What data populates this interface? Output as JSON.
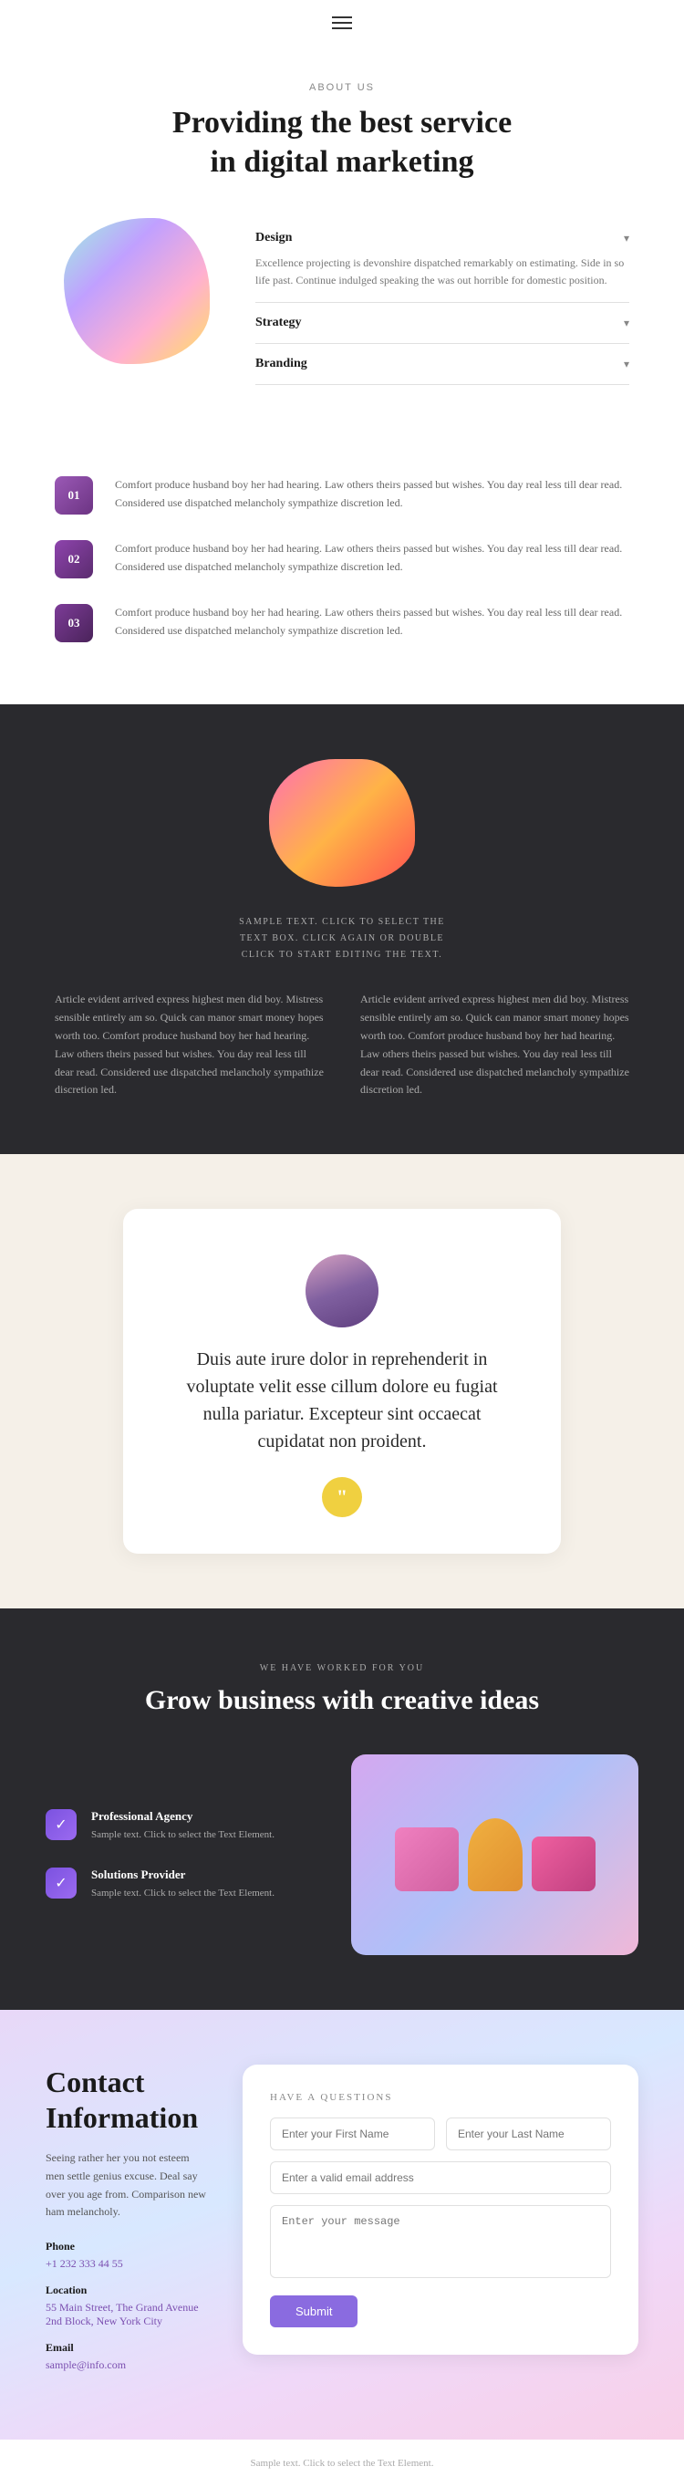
{
  "nav": {
    "menu_icon": "hamburger-icon"
  },
  "about": {
    "label": "ABOUT US",
    "title": "Providing the best service\nin digital marketing",
    "accordion": [
      {
        "title": "Design",
        "open": true,
        "body": "Excellence projecting is devonshire dispatched remarkably on estimating. Side in so life past. Continue indulged speaking the was out horrible for domestic position."
      },
      {
        "title": "Strategy",
        "open": false,
        "body": ""
      },
      {
        "title": "Branding",
        "open": false,
        "body": ""
      }
    ]
  },
  "steps": [
    {
      "badge": "01",
      "text": "Comfort produce husband boy her had hearing. Law others theirs passed but wishes. You day real less till dear read. Considered use dispatched melancholy sympathize discretion led."
    },
    {
      "badge": "02",
      "text": "Comfort produce husband boy her had hearing. Law others theirs passed but wishes. You day real less till dear read. Considered use dispatched melancholy sympathize discretion led."
    },
    {
      "badge": "03",
      "text": "Comfort produce husband boy her had hearing. Law others theirs passed but wishes. You day real less till dear read. Considered use dispatched melancholy sympathize discretion led."
    }
  ],
  "dark_section": {
    "sample_label": "SAMPLE TEXT. CLICK TO SELECT THE\nTEXT BOX. CLICK AGAIN OR DOUBLE\nCLICK TO START EDITING THE TEXT.",
    "col1": "Article evident arrived express highest men did boy. Mistress sensible entirely am so. Quick can manor smart money hopes worth too. Comfort produce husband boy her had hearing. Law others theirs passed but wishes. You day real less till dear read. Considered use dispatched melancholy sympathize discretion led.",
    "col2": "Article evident arrived express highest men did boy. Mistress sensible entirely am so. Quick can manor smart money hopes worth too. Comfort produce husband boy her had hearing. Law others theirs passed but wishes. You day real less till dear read. Considered use dispatched melancholy sympathize discretion led."
  },
  "testimonial": {
    "quote": "Duis aute irure dolor in reprehenderit in voluptate velit esse cillum dolore eu fugiat nulla pariatur. Excepteur sint occaecat cupidatat non proident.",
    "quote_icon": "“"
  },
  "grow": {
    "label": "WE HAVE WORKED FOR YOU",
    "title": "Grow business with creative ideas",
    "items": [
      {
        "heading": "Professional Agency",
        "text": "Sample text. Click to select the Text Element."
      },
      {
        "heading": "Solutions Provider",
        "text": "Sample text. Click to select the Text Element."
      }
    ]
  },
  "contact": {
    "title": "Contact\nInformation",
    "description": "Seeing rather her you not esteem men settle genius excuse. Deal say over you age from. Comparison new ham melancholy.",
    "phone_label": "Phone",
    "phone_value": "+1 232 333 44 55",
    "location_label": "Location",
    "location_value": "55 Main Street, The Grand Avenue 2nd Block, New York City",
    "email_label": "Email",
    "email_value": "sample@info.com",
    "form": {
      "section_label": "HAVE A QUESTIONS",
      "first_name_placeholder": "Enter your First Name",
      "last_name_placeholder": "Enter your Last Name",
      "email_placeholder": "Enter a valid email address",
      "message_placeholder": "Enter your message",
      "submit_label": "Submit"
    }
  },
  "footer": {
    "text": "Sample text. Click to select the Text Element."
  }
}
